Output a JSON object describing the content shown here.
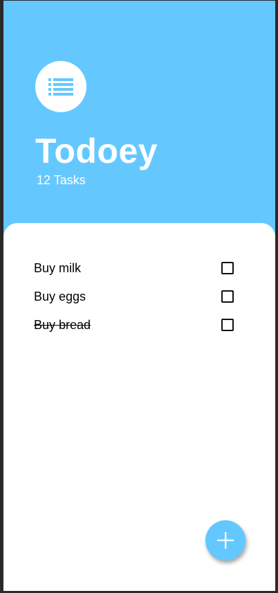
{
  "app": {
    "title": "Todoey",
    "task_count_label": "12 Tasks",
    "accent_color": "#64c8ff"
  },
  "header": {
    "logo_icon": "list-icon"
  },
  "tasks": [
    {
      "label": "Buy milk",
      "done": false,
      "checked": false
    },
    {
      "label": "Buy eggs",
      "done": false,
      "checked": false
    },
    {
      "label": "Buy bread",
      "done": true,
      "checked": false
    }
  ],
  "fab": {
    "icon": "plus-icon"
  }
}
